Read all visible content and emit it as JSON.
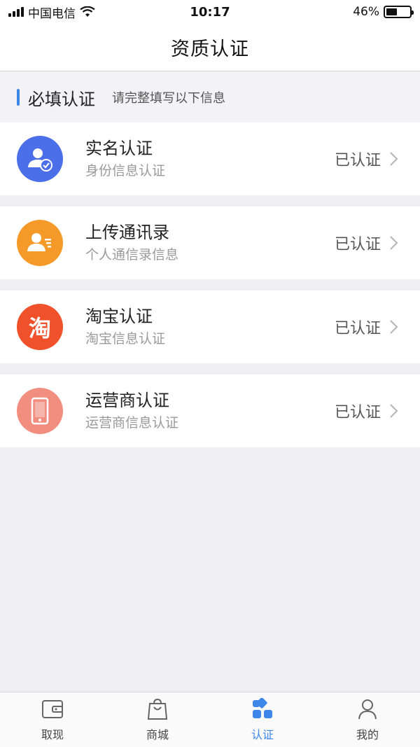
{
  "status_bar": {
    "carrier": "中国电信",
    "time": "10:17",
    "battery": "46%",
    "battery_level": 0.46
  },
  "nav": {
    "title": "资质认证"
  },
  "section": {
    "title": "必填认证",
    "subtitle": "请完整填写以下信息"
  },
  "items": [
    {
      "title": "实名认证",
      "subtitle": "身份信息认证",
      "status": "已认证",
      "icon": "identity-check-icon",
      "color": "#4a6fe8"
    },
    {
      "title": "上传通讯录",
      "subtitle": "个人通信录信息",
      "status": "已认证",
      "icon": "contacts-card-icon",
      "color": "#f59a28"
    },
    {
      "title": "淘宝认证",
      "subtitle": "淘宝信息认证",
      "status": "已认证",
      "icon": "taobao-icon",
      "color": "#f0502a",
      "glyph": "淘"
    },
    {
      "title": "运营商认证",
      "subtitle": "运营商信息认证",
      "status": "已认证",
      "icon": "mobile-phone-icon",
      "color": "#f28e80"
    }
  ],
  "tabs": [
    {
      "label": "取现",
      "icon": "wallet-icon",
      "active": false
    },
    {
      "label": "商城",
      "icon": "shopping-bag-icon",
      "active": false
    },
    {
      "label": "认证",
      "icon": "grid-icon",
      "active": true
    },
    {
      "label": "我的",
      "icon": "user-icon",
      "active": false
    }
  ],
  "colors": {
    "accent": "#3d87e8",
    "background": "#efeff4"
  }
}
